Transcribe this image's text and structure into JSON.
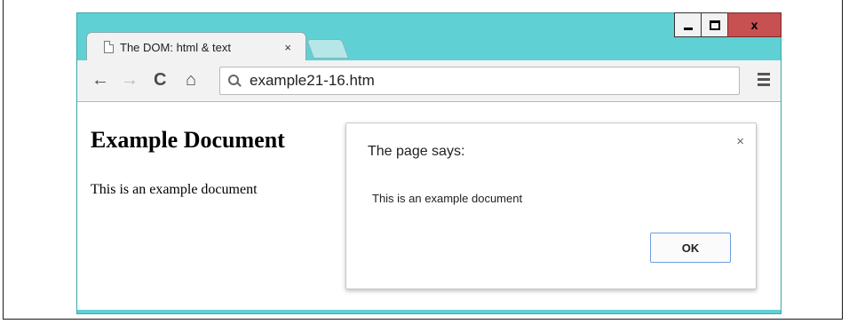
{
  "browser": {
    "tab": {
      "title": "The DOM: html & text",
      "close_glyph": "×"
    },
    "controls": {
      "minimize_icon": "minimize-icon",
      "maximize_icon": "maximize-icon",
      "close_glyph": "x"
    },
    "toolbar": {
      "back_glyph": "←",
      "forward_glyph": "→",
      "reload_glyph": "C",
      "home_glyph": "⌂",
      "url": "example21-16.htm"
    },
    "colors": {
      "frame": "#5fd1d4",
      "close_button": "#c75050",
      "ok_border": "#6e9ee0"
    }
  },
  "page": {
    "heading": "Example Document",
    "paragraph": "This is an example document"
  },
  "dialog": {
    "title": "The page says:",
    "message": "This is an example document",
    "close_glyph": "×",
    "ok_label": "OK"
  }
}
